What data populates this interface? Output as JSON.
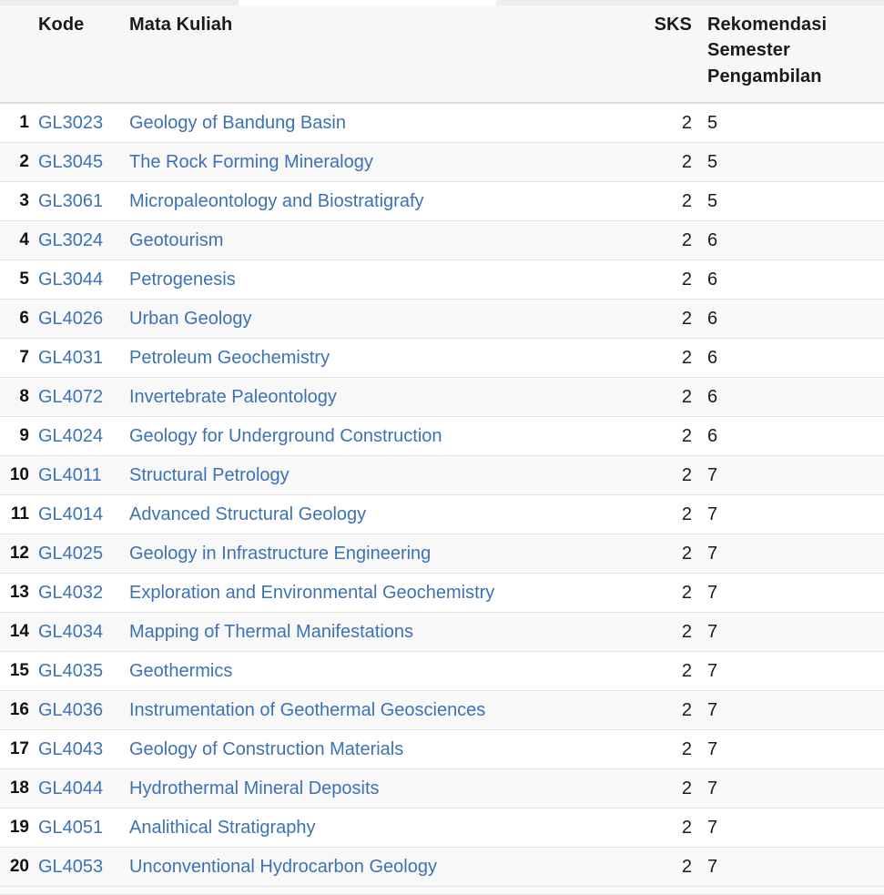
{
  "table": {
    "columns": {
      "index": "",
      "kode": "Kode",
      "mata_kuliah": "Mata Kuliah",
      "sks": "SKS",
      "rekomendasi_line1": "Rekomendasi",
      "rekomendasi_line2": "Semester Pengambilan"
    },
    "colors": {
      "link": "#3c72b5",
      "text": "#1a1a1a",
      "header_bg": "#f7f7f7",
      "row_bg": "#ffffff",
      "row_alt_bg": "#f8f8f8",
      "border": "#e4e4e4"
    },
    "rows": [
      {
        "no": "1",
        "kode": "GL3023",
        "nama": "Geology of Bandung Basin",
        "sks": "2",
        "semester": "5"
      },
      {
        "no": "2",
        "kode": "GL3045",
        "nama": "The Rock Forming Mineralogy",
        "sks": "2",
        "semester": "5"
      },
      {
        "no": "3",
        "kode": "GL3061",
        "nama": "Micropaleontology and Biostratigrafy",
        "sks": "2",
        "semester": "5"
      },
      {
        "no": "4",
        "kode": "GL3024",
        "nama": "Geotourism",
        "sks": "2",
        "semester": "6"
      },
      {
        "no": "5",
        "kode": "GL3044",
        "nama": "Petrogenesis",
        "sks": "2",
        "semester": "6"
      },
      {
        "no": "6",
        "kode": "GL4026",
        "nama": "Urban Geology",
        "sks": "2",
        "semester": "6"
      },
      {
        "no": "7",
        "kode": "GL4031",
        "nama": "Petroleum Geochemistry",
        "sks": "2",
        "semester": "6"
      },
      {
        "no": "8",
        "kode": "GL4072",
        "nama": "Invertebrate Paleontology",
        "sks": "2",
        "semester": "6"
      },
      {
        "no": "9",
        "kode": "GL4024",
        "nama": "Geology for Underground Construction",
        "sks": "2",
        "semester": "6"
      },
      {
        "no": "10",
        "kode": "GL4011",
        "nama": "Structural Petrology",
        "sks": "2",
        "semester": "7"
      },
      {
        "no": "11",
        "kode": "GL4014",
        "nama": "Advanced Structural Geology",
        "sks": "2",
        "semester": "7"
      },
      {
        "no": "12",
        "kode": "GL4025",
        "nama": "Geology in Infrastructure Engineering",
        "sks": "2",
        "semester": "7"
      },
      {
        "no": "13",
        "kode": "GL4032",
        "nama": "Exploration and Environmental Geochemistry",
        "sks": "2",
        "semester": "7"
      },
      {
        "no": "14",
        "kode": "GL4034",
        "nama": "Mapping of Thermal Manifestations",
        "sks": "2",
        "semester": "7"
      },
      {
        "no": "15",
        "kode": "GL4035",
        "nama": "Geothermics",
        "sks": "2",
        "semester": "7"
      },
      {
        "no": "16",
        "kode": "GL4036",
        "nama": "Instrumentation of Geothermal Geosciences",
        "sks": "2",
        "semester": "7"
      },
      {
        "no": "17",
        "kode": "GL4043",
        "nama": "Geology of Construction Materials",
        "sks": "2",
        "semester": "7"
      },
      {
        "no": "18",
        "kode": "GL4044",
        "nama": "Hydrothermal Mineral Deposits",
        "sks": "2",
        "semester": "7"
      },
      {
        "no": "19",
        "kode": "GL4051",
        "nama": "Analithical Stratigraphy",
        "sks": "2",
        "semester": "7"
      },
      {
        "no": "20",
        "kode": "GL4053",
        "nama": "Unconventional Hydrocarbon Geology",
        "sks": "2",
        "semester": "7"
      }
    ]
  }
}
